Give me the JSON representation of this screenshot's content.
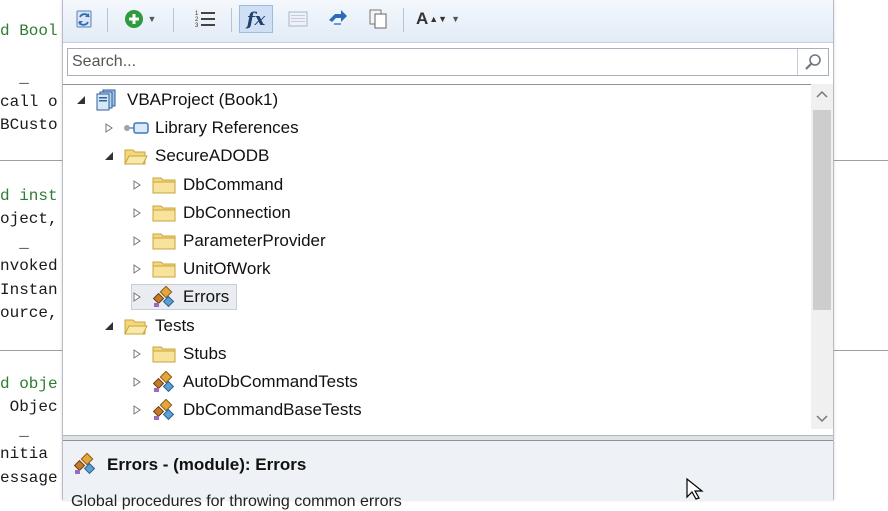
{
  "code_lines": [
    {
      "text": "d Bool",
      "type": "comment"
    },
    {
      "text": "",
      "type": "code"
    },
    {
      "text": "  _",
      "type": "code"
    },
    {
      "text": "call o",
      "type": "code"
    },
    {
      "text": "BCusto",
      "type": "code"
    },
    {
      "text": "",
      "type": "code"
    },
    {
      "text": "",
      "type": "code"
    },
    {
      "text": "d inst",
      "type": "comment"
    },
    {
      "text": "oject,",
      "type": "code"
    },
    {
      "text": "  _",
      "type": "code"
    },
    {
      "text": "nvoked",
      "type": "code"
    },
    {
      "text": "Instan",
      "type": "code"
    },
    {
      "text": "ource,",
      "type": "code"
    },
    {
      "text": "",
      "type": "code"
    },
    {
      "text": "",
      "type": "code"
    },
    {
      "text": "d obje",
      "type": "comment"
    },
    {
      "text": " Objec",
      "type": "code"
    },
    {
      "text": "  _",
      "type": "code"
    },
    {
      "text": "nitia",
      "type": "code"
    },
    {
      "text": "essage",
      "type": "code"
    }
  ],
  "search": {
    "placeholder": "Search...",
    "value": ""
  },
  "toolbar": {
    "buttons": [
      {
        "name": "refresh",
        "icon": "refresh-icon"
      },
      {
        "name": "add",
        "icon": "plus-circle-icon"
      },
      {
        "name": "sort",
        "icon": "numbered-list-icon"
      },
      {
        "name": "show-signatures",
        "icon": "fx-icon",
        "glyph": "fx",
        "active": true
      },
      {
        "name": "panel",
        "icon": "panel-icon"
      },
      {
        "name": "sync",
        "icon": "sync-icon"
      },
      {
        "name": "copy",
        "icon": "copy-icon"
      },
      {
        "name": "font-size",
        "icon": "font-size-icon",
        "glyph": "A"
      }
    ]
  },
  "tree": {
    "nodes": [
      {
        "label": "VBAProject (Book1)",
        "level": 0,
        "icon": "project-icon",
        "expanded": true
      },
      {
        "label": "Library References",
        "level": 1,
        "icon": "references-icon",
        "expanded": false
      },
      {
        "label": "SecureADODB",
        "level": 1,
        "icon": "folder-open-icon",
        "expanded": true
      },
      {
        "label": "DbCommand",
        "level": 2,
        "icon": "folder-icon",
        "expanded": false
      },
      {
        "label": "DbConnection",
        "level": 2,
        "icon": "folder-icon",
        "expanded": false
      },
      {
        "label": "ParameterProvider",
        "level": 2,
        "icon": "folder-icon",
        "expanded": false
      },
      {
        "label": "UnitOfWork",
        "level": 2,
        "icon": "folder-icon",
        "expanded": false
      },
      {
        "label": "Errors",
        "level": 2,
        "icon": "module-icon",
        "expanded": false,
        "selected": true
      },
      {
        "label": "Tests",
        "level": 1,
        "icon": "folder-open-icon",
        "expanded": true
      },
      {
        "label": "Stubs",
        "level": 2,
        "icon": "folder-icon",
        "expanded": false
      },
      {
        "label": "AutoDbCommandTests",
        "level": 2,
        "icon": "module-icon",
        "expanded": false
      },
      {
        "label": "DbCommandBaseTests",
        "level": 2,
        "icon": "module-icon",
        "expanded": false
      }
    ]
  },
  "details": {
    "title": "Errors - (module): Errors",
    "description": "Global procedures for throwing common errors"
  },
  "colors": {
    "folder": "#f3d77b",
    "folder_border": "#c9a43e",
    "selection": "#e9ecf0",
    "toolbar": "#e2ebf6",
    "comment": "#2e7d32"
  }
}
